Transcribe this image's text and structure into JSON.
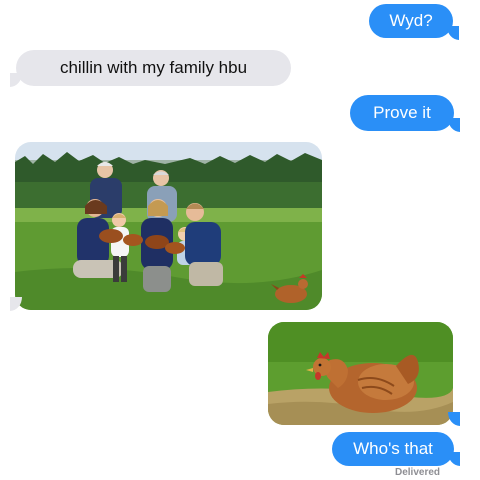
{
  "messages": [
    {
      "side": "sent",
      "text": "Wyd?"
    },
    {
      "side": "received",
      "text": "chillin with my family hbu"
    },
    {
      "side": "sent",
      "text": "Prove it"
    },
    {
      "side": "received",
      "type": "photo",
      "icon": "family-with-chickens-photo"
    },
    {
      "side": "sent",
      "type": "photo",
      "icon": "chicken-photo"
    },
    {
      "side": "sent",
      "text": "Who's that"
    }
  ],
  "status": "Delivered",
  "colors": {
    "sent_bubble": "#2a8ff7",
    "received_bubble": "#e6e6eb",
    "sent_text": "#ffffff",
    "received_text": "#111111",
    "status_text": "#8e8e93"
  }
}
